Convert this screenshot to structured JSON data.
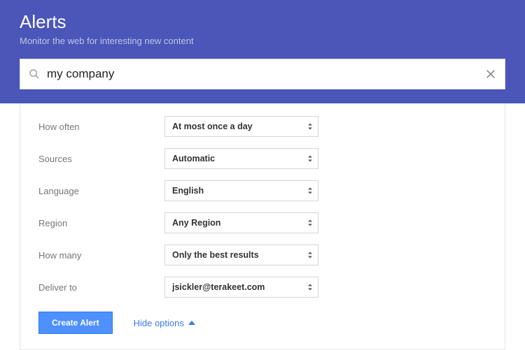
{
  "header": {
    "title": "Alerts",
    "subtitle": "Monitor the web for interesting new content"
  },
  "search": {
    "value": "my company"
  },
  "options": {
    "how_often": {
      "label": "How often",
      "value": "At most once a day"
    },
    "sources": {
      "label": "Sources",
      "value": "Automatic"
    },
    "language": {
      "label": "Language",
      "value": "English"
    },
    "region": {
      "label": "Region",
      "value": "Any Region"
    },
    "how_many": {
      "label": "How many",
      "value": "Only the best results"
    },
    "deliver_to": {
      "label": "Deliver to",
      "value": "jsickler@terakeet.com"
    }
  },
  "actions": {
    "create": "Create Alert",
    "hide": "Hide options"
  }
}
